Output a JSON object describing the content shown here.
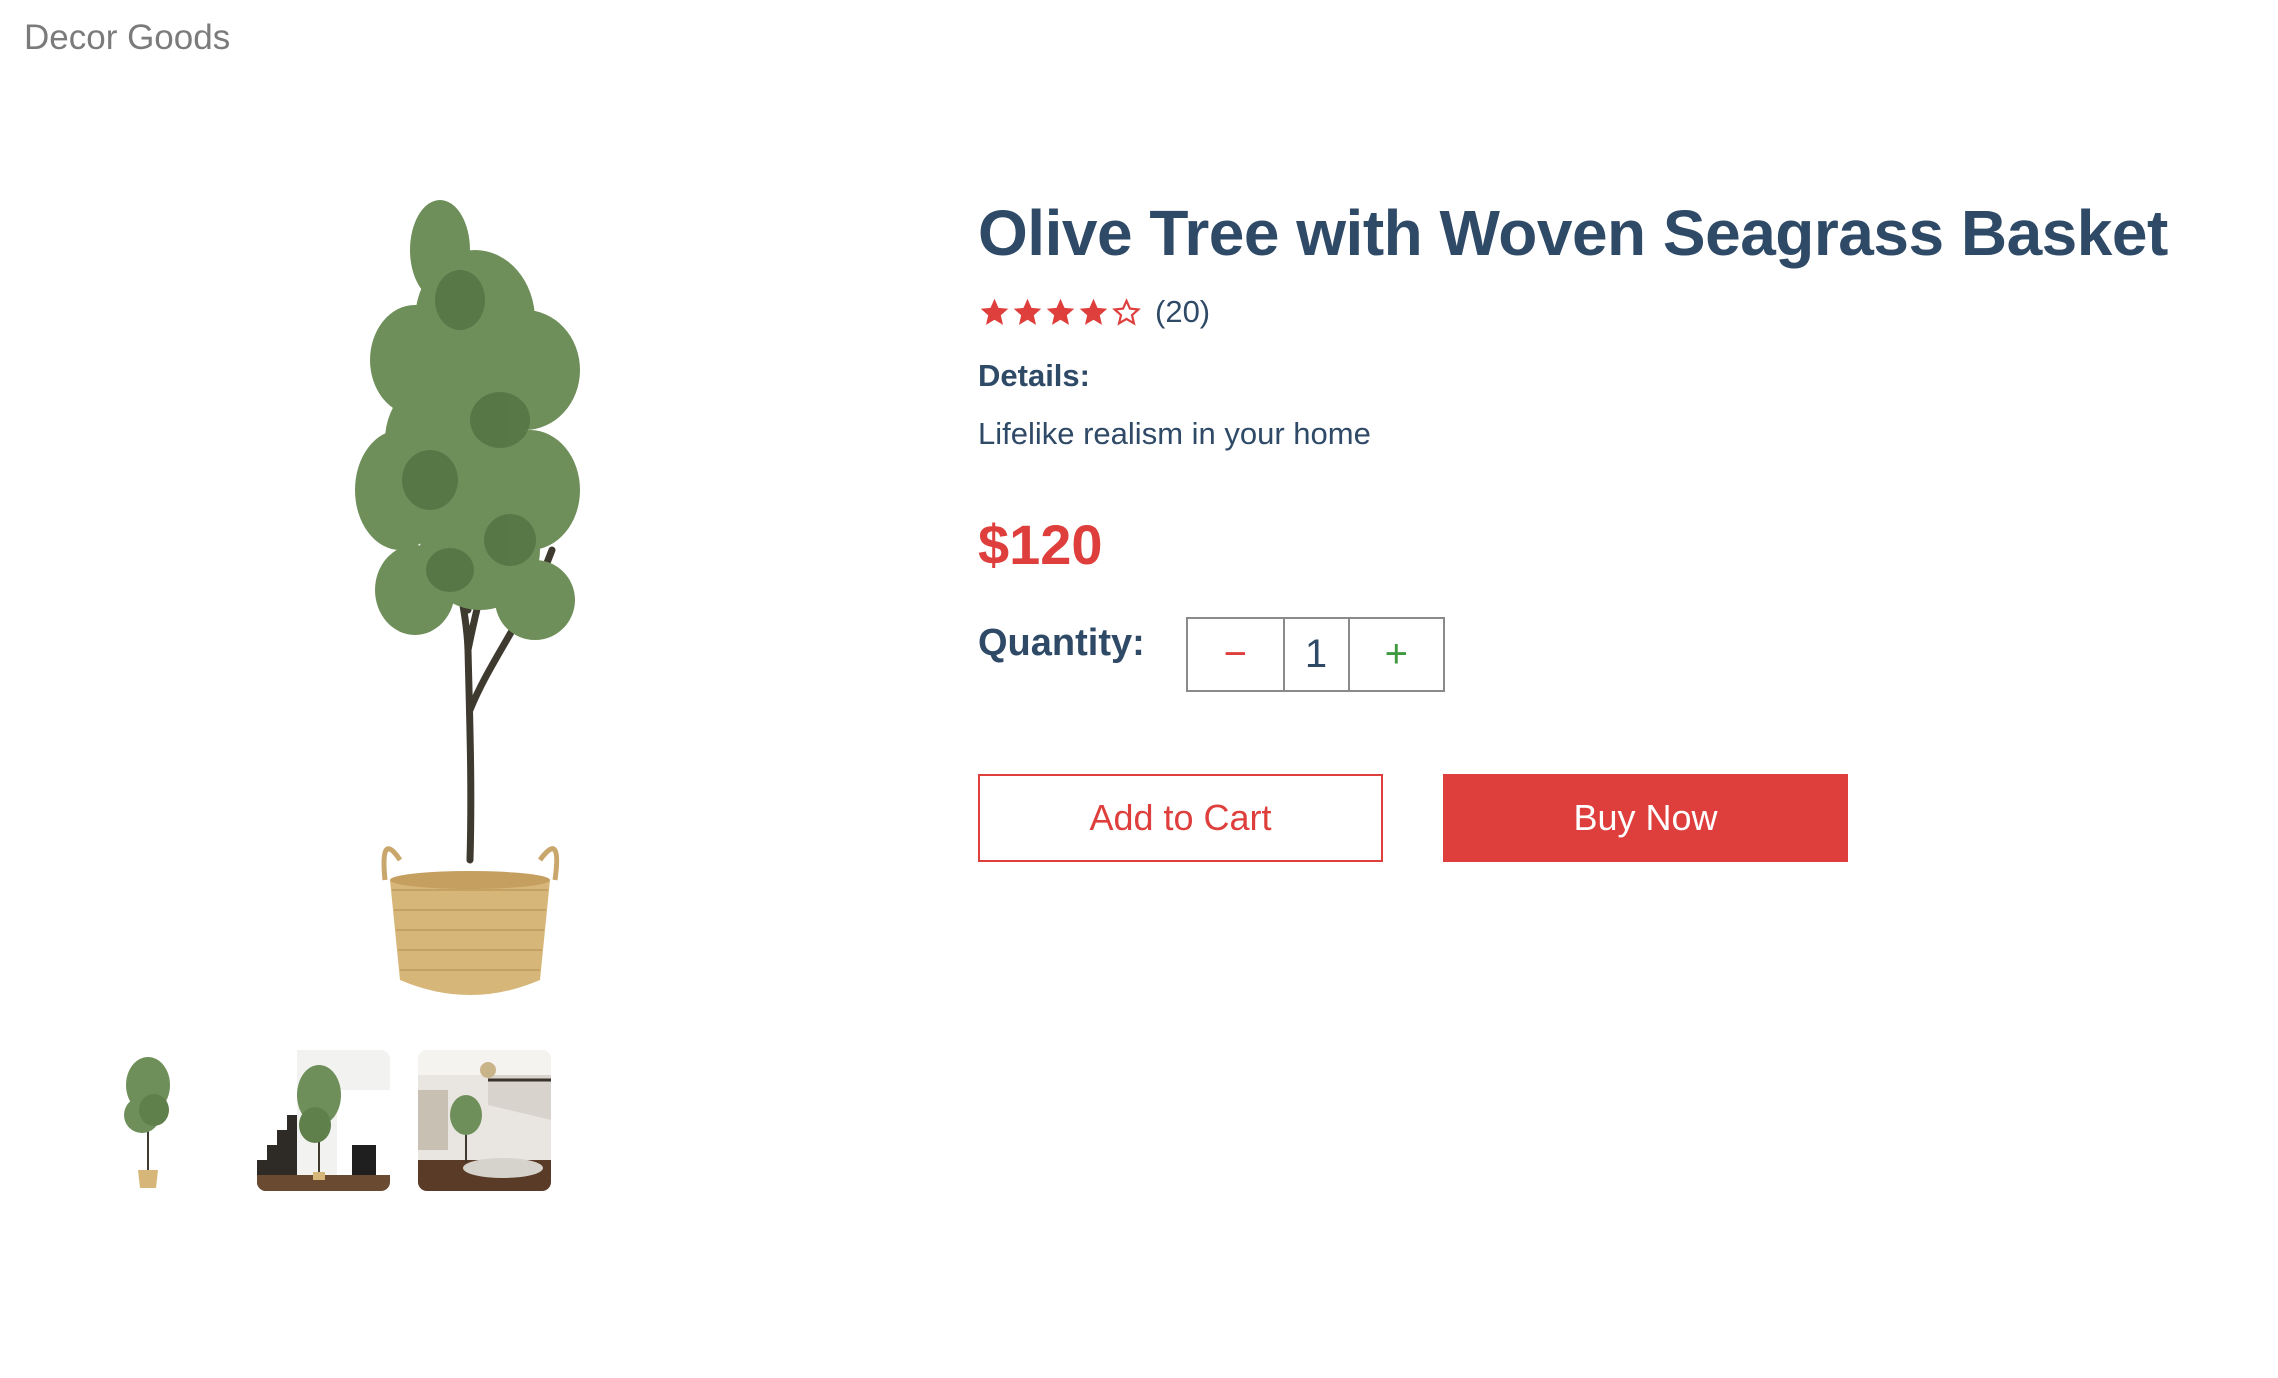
{
  "header": {
    "brand": "Decor Goods"
  },
  "gallery": {
    "main_image": "olive-tree-in-basket",
    "thumbnails": [
      "olive-tree-in-basket",
      "olive-tree-by-stairs",
      "olive-tree-in-foyer"
    ]
  },
  "product": {
    "title": "Olive Tree with Woven Seagrass Basket",
    "rating": {
      "filled_stars": 4,
      "total_stars": 5,
      "count_label": "(20)"
    },
    "details_label": "Details:",
    "details_text": "Lifelike realism in your home",
    "price": "$120",
    "quantity_label": "Quantity:",
    "quantity": {
      "minus": "−",
      "value": "1",
      "plus": "+"
    },
    "add_to_cart_label": "Add to Cart",
    "buy_now_label": "Buy Now"
  },
  "colors": {
    "accent": "#de3f3c",
    "text": "#2f4a67",
    "brand_text": "#7b7b7b",
    "plus": "#3e9a3e"
  }
}
